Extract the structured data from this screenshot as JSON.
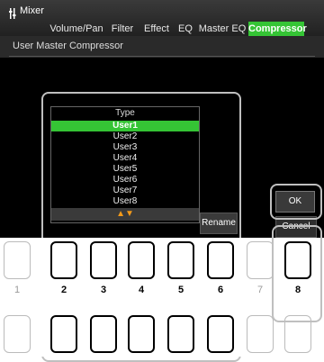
{
  "header": {
    "app_title": "Mixer",
    "tabs": [
      {
        "label": "Volume/Pan"
      },
      {
        "label": "Filter"
      },
      {
        "label": "Effect"
      },
      {
        "label": "EQ"
      },
      {
        "label": "Master EQ"
      },
      {
        "label": "Compressor",
        "active": true
      }
    ],
    "subtitle": "User Master Compressor"
  },
  "popup": {
    "heading": "Type",
    "items": [
      "User1",
      "User2",
      "User3",
      "User4",
      "User5",
      "User6",
      "User7",
      "User8"
    ],
    "selected": "User1",
    "scroll_arrows": "▲▼",
    "rename_label": "Rename"
  },
  "dialog": {
    "ok_label": "OK",
    "cancel_label": "Cancel"
  },
  "buttons": {
    "numbers": [
      "1",
      "2",
      "3",
      "4",
      "5",
      "6",
      "7",
      "8"
    ]
  },
  "colors": {
    "accent": "#35c435",
    "arrow": "#f39a1a"
  }
}
